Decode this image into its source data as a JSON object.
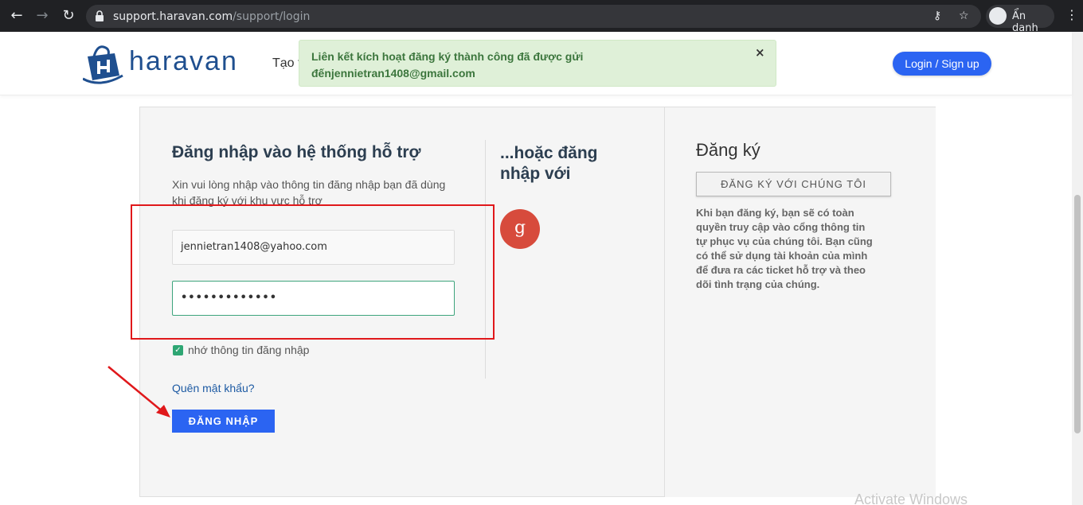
{
  "browser": {
    "url_host": "support.haravan.com",
    "url_path": "/support/login",
    "incognito_label": "Ẩn danh"
  },
  "header": {
    "logo_text": "haravan",
    "nav_partial": "Tạo t",
    "login_button": "Login / Sign up"
  },
  "alert": {
    "message": "Liên kết kích hoạt đăng ký thành công đã được gửi đếnjennietran1408@gmail.com",
    "close": "×"
  },
  "login": {
    "title": "Đăng nhập vào hệ thống hỗ trợ",
    "description": "Xin vui lòng nhập vào thông tin đăng nhập bạn đã dùng khi đăng ký với khu vực hỗ trợ",
    "email_value": "jennietran1408@yahoo.com",
    "password_mask": "•••••••••••••",
    "remember_label": "nhớ thông tin đăng nhập",
    "remember_checked": true,
    "forgot_link": "Quên mật khẩu?",
    "submit_label": "ĐĂNG NHẬP"
  },
  "social": {
    "title": "...hoặc đăng nhập với",
    "google_glyph": "g"
  },
  "register": {
    "title": "Đăng ký",
    "button": "ĐĂNG KÝ VỚI CHÚNG TÔI",
    "description": "Khi bạn đăng ký, bạn sẽ có toàn quyền truy cập vào cổng thông tin tự phục vụ của chúng tôi. Bạn cũng có thể sử dụng tài khoản của mình để đưa ra các ticket hỗ trợ và theo dõi tình trạng của chúng."
  },
  "watermark": "Activate Windows",
  "colors": {
    "brand_blue": "#2b64f2",
    "alert_green_bg": "#dff0d8",
    "alert_green_text": "#3c763d",
    "google_red": "#d74b3c",
    "annotation_red": "#e0181b"
  }
}
